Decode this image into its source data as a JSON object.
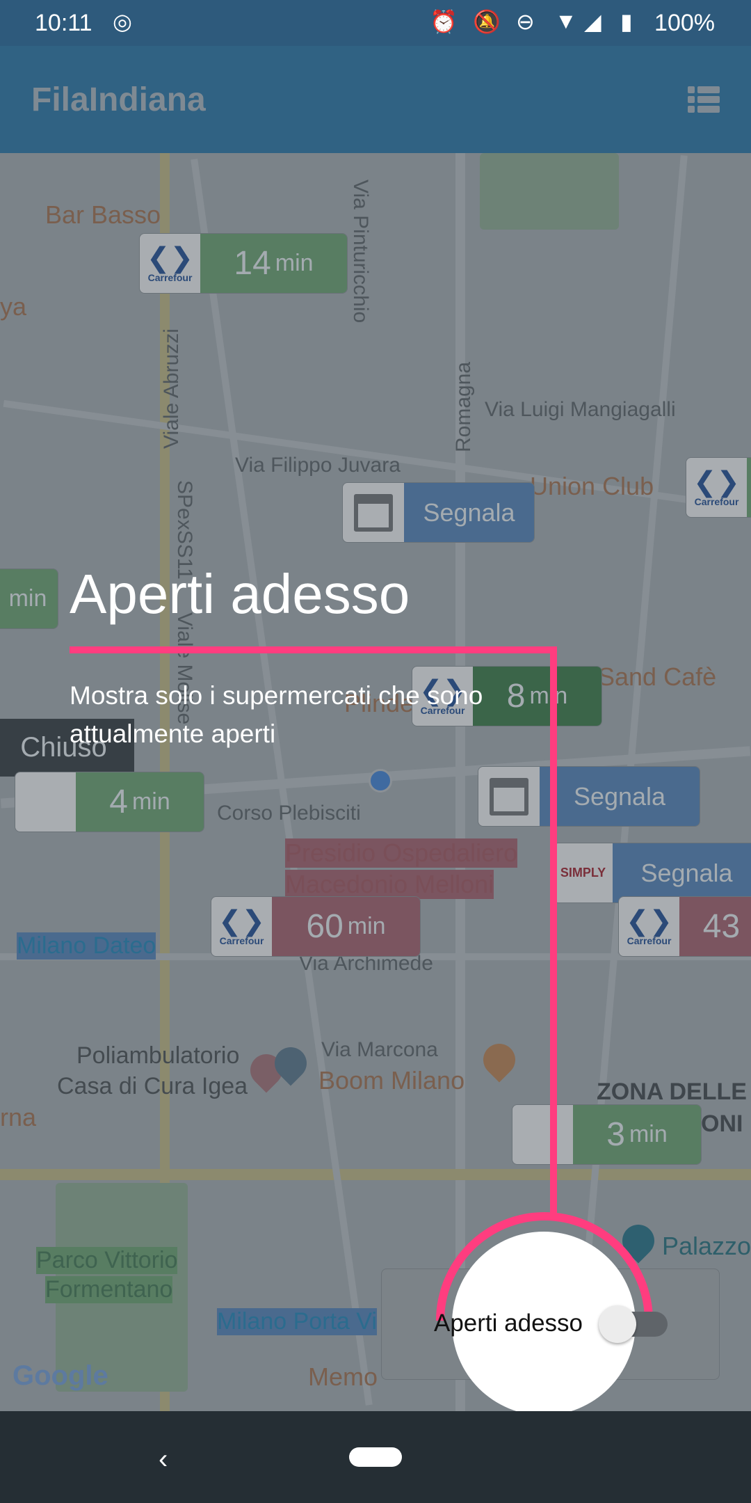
{
  "status_bar": {
    "time": "10:11",
    "battery": "100%",
    "icons": [
      "data-saver-icon",
      "alarm-icon",
      "bell-off-icon",
      "do-not-disturb-icon",
      "wifi-icon",
      "signal-icon",
      "battery-charging-icon"
    ]
  },
  "app_bar": {
    "title": "FilaIndiana",
    "list_icon": "list-icon"
  },
  "map": {
    "labels": [
      "Bar Basso",
      "Via Pinturicchio",
      "Viale Abruzzi",
      "Via Luigi Mangiagalli",
      "Via Filippo Juvara",
      "Union Club",
      "Romagna",
      "Sand Cafè",
      "Corso Plebisciti",
      "Presidio Ospedaliero",
      "Macedonio Melloni",
      "Milano Dateo",
      "Via Archimede",
      "Poliambulatorio",
      "Casa di Cura Igea",
      "Via Marcona",
      "Boom Milano",
      "ZONA DELLE",
      "ONI",
      "Parco Vittorio",
      "Formentano",
      "Milano Porta Vi",
      "Palazzo",
      "Memo",
      "SPexSS11",
      "Viale Molise",
      "Plinder",
      "rna",
      "ya"
    ],
    "google": "Google",
    "markers": [
      {
        "brand": "Carrefour",
        "value": "14",
        "unit": "min",
        "status": "green"
      },
      {
        "brand": "shop",
        "value": "Segnala",
        "status": "blue"
      },
      {
        "brand": "Carrefour",
        "value": "",
        "status": "green"
      },
      {
        "brand": "",
        "value": "",
        "unit": "min",
        "status": "green"
      },
      {
        "brand": "Carrefour",
        "value": "8",
        "unit": "min",
        "status": "green"
      },
      {
        "value": "Chiuso",
        "status": "closed"
      },
      {
        "brand": "",
        "value": "4",
        "unit": "min",
        "status": "green"
      },
      {
        "brand": "shop",
        "value": "Segnala",
        "status": "blue"
      },
      {
        "brand": "SIMPLY",
        "value": "Segnala",
        "status": "blue"
      },
      {
        "brand": "Carrefour",
        "value": "60",
        "unit": "min",
        "status": "red"
      },
      {
        "brand": "Carrefour",
        "value": "43",
        "status": "red"
      },
      {
        "brand": "",
        "value": "3",
        "unit": "min",
        "status": "green"
      }
    ]
  },
  "tutorial": {
    "title": "Aperti adesso",
    "description": "Mostra solo i supermercati che sono attualmente aperti",
    "accent": "#ff3d7f"
  },
  "filter_panel": {
    "label": "Aperti adesso",
    "toggle_on": false
  },
  "nav": {
    "back": "‹"
  }
}
